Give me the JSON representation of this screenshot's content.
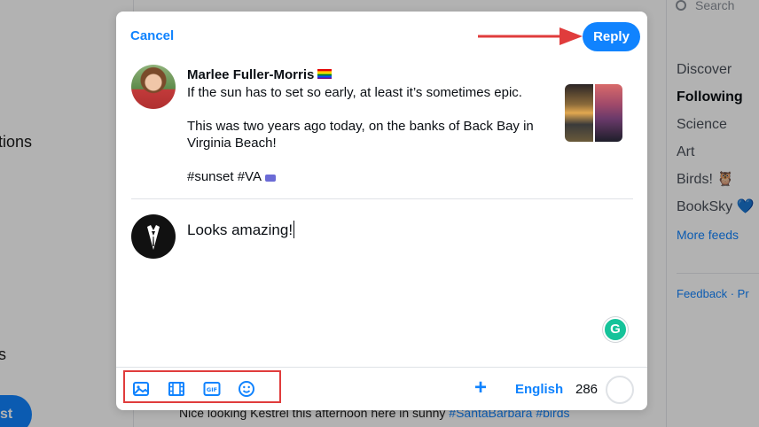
{
  "background": {
    "left_fragment": "tions",
    "left_fragment2": "s",
    "left_button": "st",
    "search_placeholder": "Search",
    "feeds": [
      "Discover",
      "Following",
      "Science",
      "Art",
      "Birds! 🦉",
      "BookSky 💙",
      "More feeds"
    ],
    "feedback": "Feedback · Pr",
    "feed_bottom_text": "Nice looking Kestrel this afternoon here in sunny ",
    "feed_bottom_tags": "#SantaBarbara #birds"
  },
  "modal": {
    "cancel_label": "Cancel",
    "reply_label": "Reply",
    "post": {
      "author": "Marlee Fuller-Morris",
      "lines": [
        "If the sun has to set so early, at least it’s sometimes epic.",
        "This was two years ago today, on the banks of Back Bay in Virginia Beach!",
        "#sunset #VA"
      ]
    },
    "draft_text": "Looks amazing!",
    "grammarly_label": "G",
    "toolbar": {
      "icons": [
        "image-icon",
        "video-icon",
        "gif-icon",
        "emoji-icon"
      ],
      "language": "English",
      "char_count": "286"
    }
  },
  "colors": {
    "accent": "#1083fe",
    "annotation_red": "#e03c3c",
    "grammarly": "#15c39a"
  }
}
